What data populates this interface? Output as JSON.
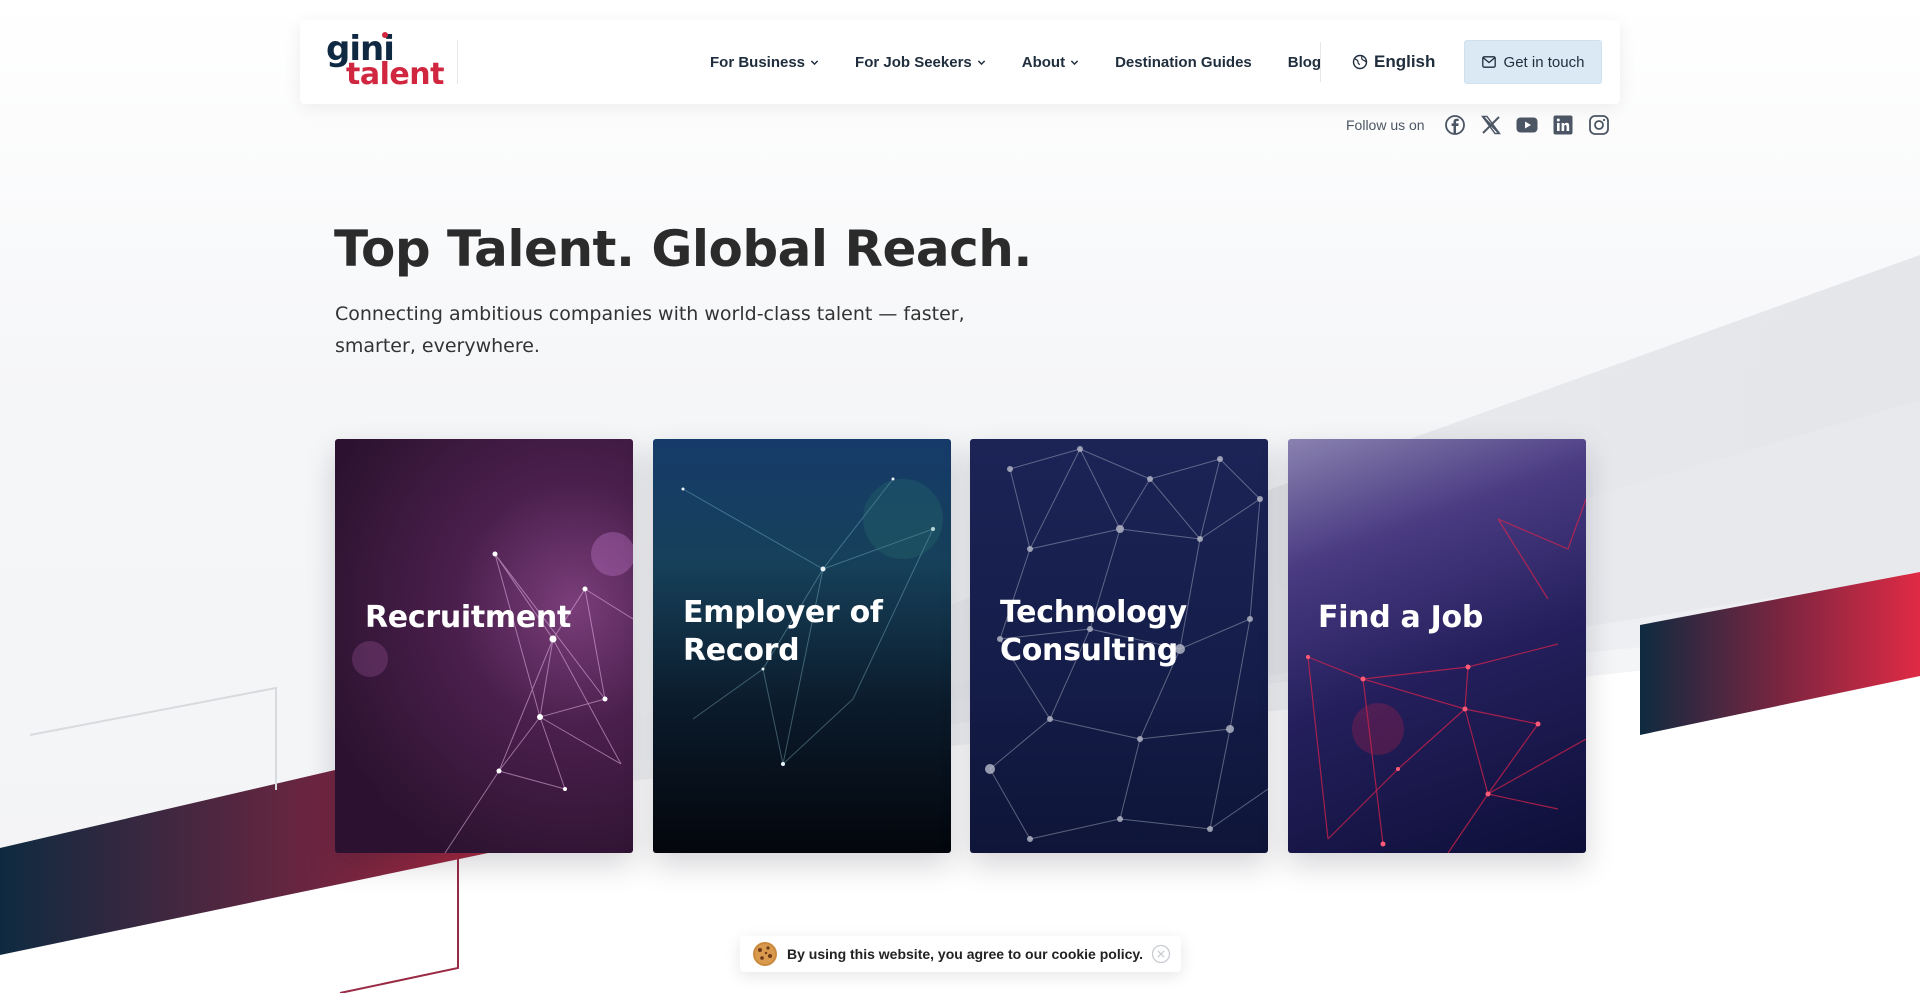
{
  "brand": {
    "logo_top": "gini",
    "logo_bottom": "talent",
    "primary_color": "#0f2942",
    "accent_color": "#d0263f"
  },
  "nav": {
    "items": [
      {
        "label": "For Business",
        "dropdown": true
      },
      {
        "label": "For Job Seekers",
        "dropdown": true
      },
      {
        "label": "About",
        "dropdown": true
      },
      {
        "label": "Destination Guides",
        "dropdown": false
      },
      {
        "label": "Blog",
        "dropdown": false
      }
    ],
    "language": "English",
    "cta_label": "Get in touch"
  },
  "social": {
    "label": "Follow us on",
    "icons": [
      "facebook-icon",
      "x-icon",
      "youtube-icon",
      "linkedin-icon",
      "instagram-icon"
    ]
  },
  "hero": {
    "title": "Top Talent. Global Reach.",
    "subtitle": "Connecting ambitious companies with world-class talent — faster, smarter, everywhere."
  },
  "cards": [
    {
      "title": "Recruitment"
    },
    {
      "title": "Employer of Record"
    },
    {
      "title": "Technology Consulting"
    },
    {
      "title": "Find a Job"
    }
  ],
  "cookie": {
    "text": "By using this website, you agree to our cookie policy."
  }
}
